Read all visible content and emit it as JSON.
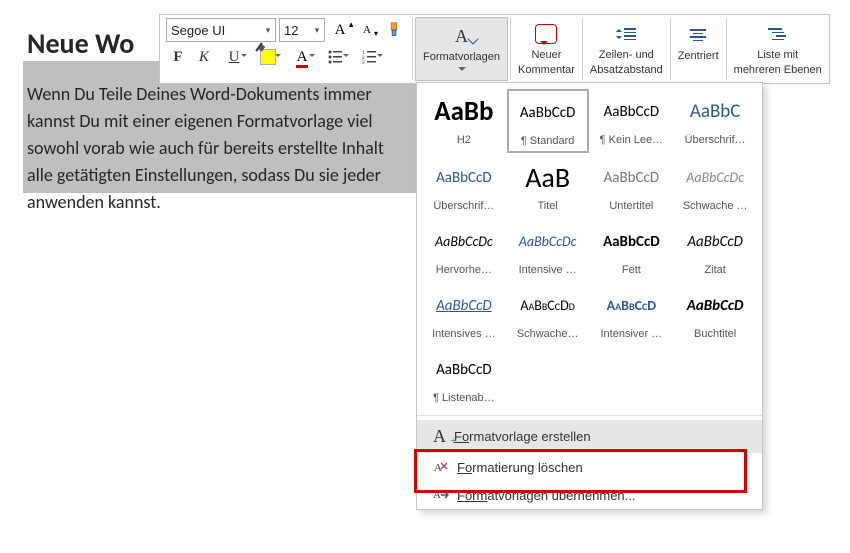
{
  "doc": {
    "title": "Neue Wo",
    "body_line1": "Wenn Du Teile Deines Word-Dokuments immer",
    "body_line2": "kannst Du mit einer eigenen Formatvorlage viel",
    "body_line3": "sowohl vorab wie auch für bereits erstellte Inhalt",
    "body_line4": "alle getätigten Einstellungen, sodass Du sie jeder",
    "body_line5": "anwenden kannst."
  },
  "toolbar": {
    "font_name": "Segoe UI",
    "font_size": "12",
    "styles_label": "Formatvorlagen",
    "new_comment_l1": "Neuer",
    "new_comment_l2": "Kommentar",
    "spacing_l1": "Zeilen- und",
    "spacing_l2": "Absatzabstand",
    "center_label": "Zentriert",
    "multi_l1": "Liste mit",
    "multi_l2": "mehreren Ebenen"
  },
  "styles": [
    {
      "preview": "AaBb",
      "label": "H2",
      "css": "font-size:27px;font-weight:700;"
    },
    {
      "preview": "AaBbCcD",
      "label": "¶ Standard",
      "css": "font-size:15px;",
      "selected": true
    },
    {
      "preview": "AaBbCcD",
      "label": "¶ Kein Lee…",
      "css": "font-size:15px;"
    },
    {
      "preview": "AaBbC",
      "label": "Überschrif…",
      "css": "font-size:19px;color:#2f5597;"
    },
    {
      "preview": "AaBbCcD",
      "label": "Überschrif…",
      "css": "font-size:15px;color:#2f5597;"
    },
    {
      "preview": "AaB",
      "label": "Titel",
      "css": "font-size:28px;"
    },
    {
      "preview": "AaBbCcD",
      "label": "Untertitel",
      "css": "font-size:15px;color:#777;"
    },
    {
      "preview": "AaBbCcDc",
      "label": "Schwache …",
      "css": "font-size:14px;font-style:italic;color:#888;"
    },
    {
      "preview": "AaBbCcDc",
      "label": "Hervorhe…",
      "css": "font-size:14px;font-style:italic;"
    },
    {
      "preview": "AaBbCcDc",
      "label": "Intensive …",
      "css": "font-size:14px;font-style:italic;color:#2f5597;"
    },
    {
      "preview": "AaBbCcD",
      "label": "Fett",
      "css": "font-size:15px;font-weight:700;"
    },
    {
      "preview": "AaBbCcD",
      "label": "Zitat",
      "css": "font-size:15px;font-style:italic;"
    },
    {
      "preview": "AaBbCcD",
      "label": "Intensives …",
      "css": "font-size:15px;font-style:italic;color:#2f5597;text-decoration:underline;"
    },
    {
      "preview": "AaBbCcDd",
      "label": "Schwache…",
      "css": "font-size:14px;font-variant:small-caps;"
    },
    {
      "preview": "AaBbCcD",
      "label": "Intensiver …",
      "css": "font-size:14px;font-variant:small-caps;font-weight:700;color:#2f5597;"
    },
    {
      "preview": "AaBbCcD",
      "label": "Buchtitel",
      "css": "font-size:15px;font-style:italic;font-weight:700;"
    },
    {
      "preview": "AaBbCcD",
      "label": "¶ Listenab…",
      "css": "font-size:15px;"
    }
  ],
  "menu": {
    "create": "rmatvorlage erstellen",
    "create_u": "Fo",
    "clear": "rmatierung löschen",
    "clear_u": "Fo",
    "apply": "atvorlagen übernehmen...",
    "apply_u": "Form"
  }
}
